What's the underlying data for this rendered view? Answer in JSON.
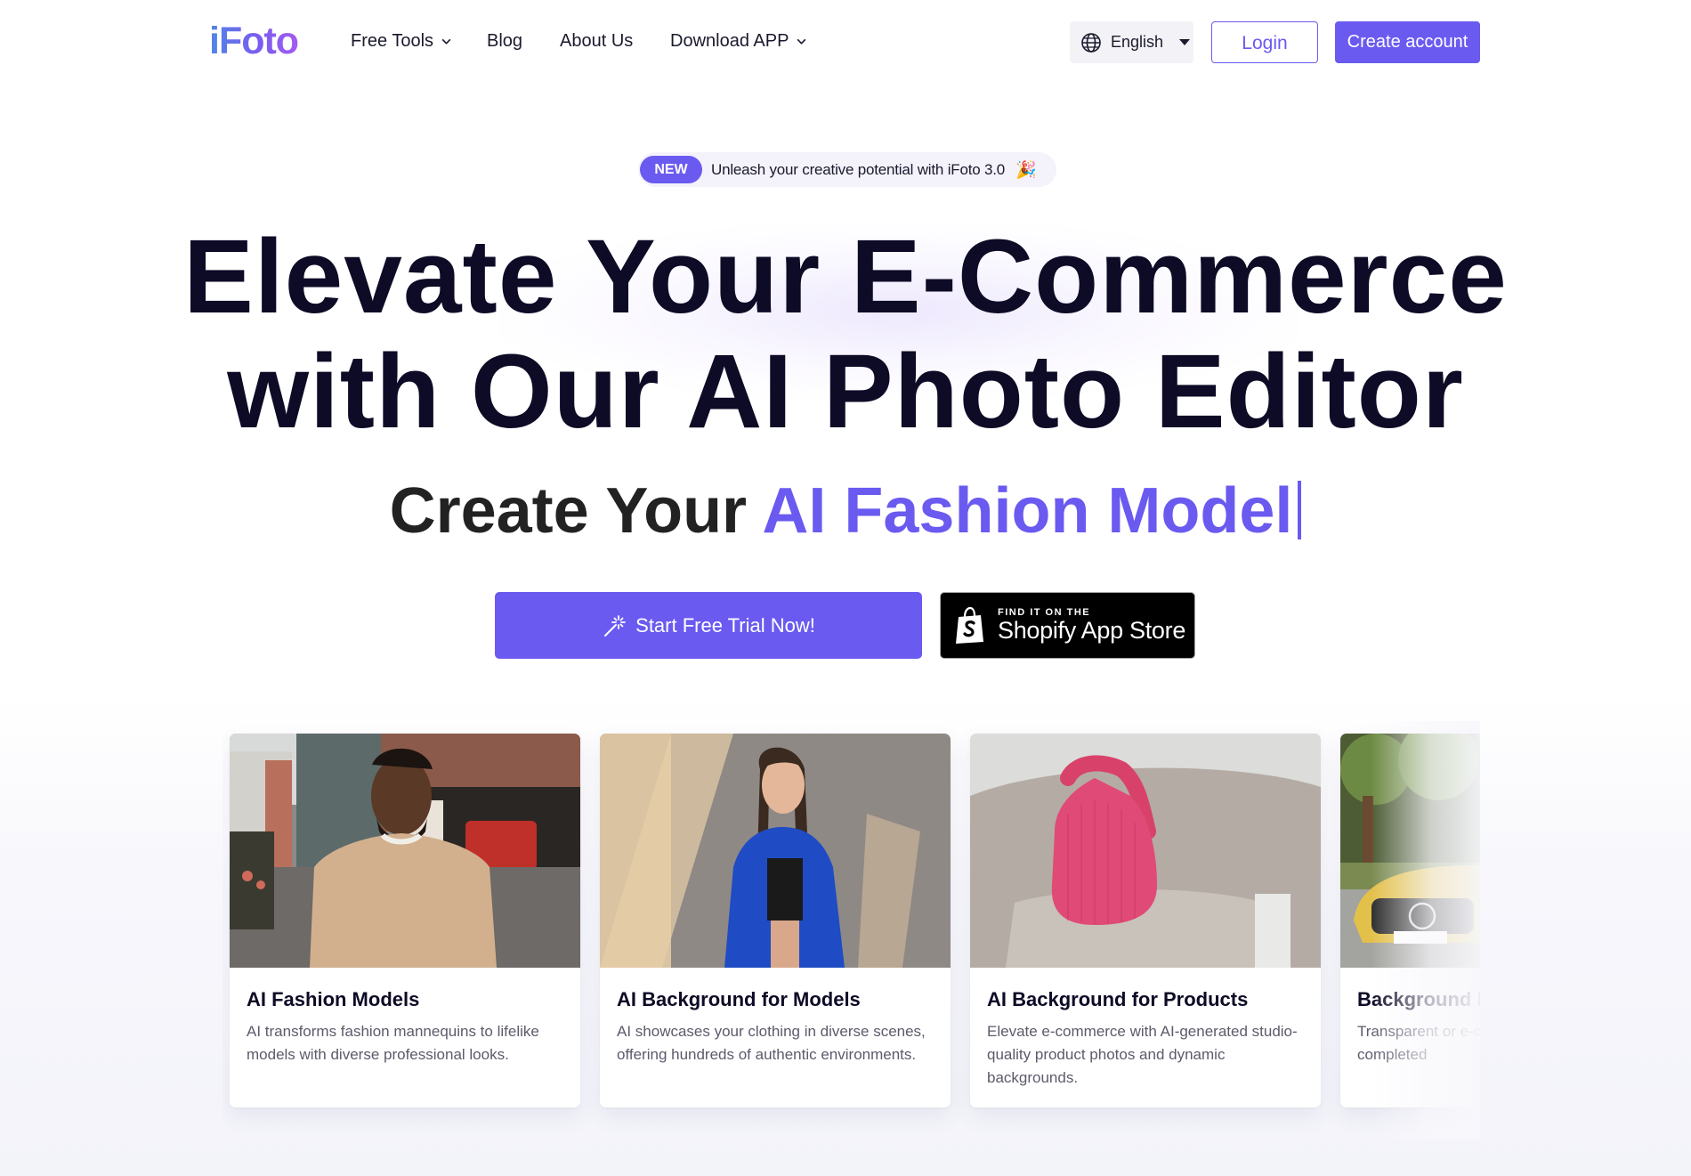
{
  "header": {
    "logo": "iFoto",
    "nav": [
      {
        "label": "Free Tools",
        "has_dropdown": true
      },
      {
        "label": "Blog",
        "has_dropdown": false
      },
      {
        "label": "About Us",
        "has_dropdown": false
      },
      {
        "label": "Download APP",
        "has_dropdown": true
      }
    ],
    "language": {
      "selected": "English",
      "icon": "globe-icon"
    },
    "login_label": "Login",
    "create_account_label": "Create account"
  },
  "hero": {
    "badge": {
      "tag": "NEW",
      "text": "Unleash your creative potential with iFoto 3.0",
      "emoji": "🎉"
    },
    "headline_line1": "Elevate Your E-Commerce",
    "headline_line2": "with Our AI Photo Editor",
    "subline_prefix": "Create Your",
    "subline_accent": "AI Fashion Model",
    "cta_trial": {
      "label": "Start Free Trial Now!",
      "icon": "magic-wand-icon"
    },
    "cta_shopify": {
      "small": "FIND IT ON THE",
      "big": "Shopify App Store",
      "icon": "shopify-bag-icon"
    }
  },
  "cards": [
    {
      "title": "AI Fashion Models",
      "description": "AI transforms fashion mannequins to lifelike models with diverse professional looks.",
      "image": "man in beige t-shirt on a street"
    },
    {
      "title": "AI Background for Models",
      "description": "AI showcases your clothing in diverse scenes, offering hundreds of authentic environments.",
      "image": "woman in blue denim jacket against wall"
    },
    {
      "title": "AI Background for Products",
      "description": "Elevate e-commerce with AI-generated studio-quality product photos and dynamic backgrounds.",
      "image": "pink handbag on grey armchair"
    },
    {
      "title": "Background Remover",
      "description": "Transparent or e-commerce backgrounds completed",
      "image": "yellow car in front of trees"
    }
  ],
  "colors": {
    "accent": "#6a5af0",
    "heading": "#0d0b26",
    "shopify_bg": "#000000"
  }
}
